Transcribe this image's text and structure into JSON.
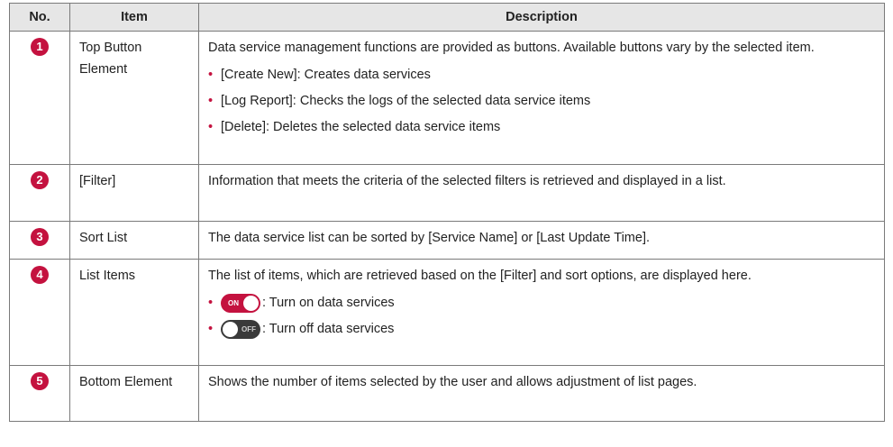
{
  "headers": {
    "no": "No.",
    "item": "Item",
    "description": "Description"
  },
  "rows": [
    {
      "no": "1",
      "item": "Top Button Element",
      "text": "Data service management functions are provided as buttons. Available buttons vary by the selected item.",
      "bullets": [
        "[Create New]: Creates data services",
        "[Log Report]: Checks the logs of the selected data service items",
        "[Delete]: Deletes the selected data service items"
      ]
    },
    {
      "no": "2",
      "item": "[Filter]",
      "text": "Information that meets the criteria of the selected filters is retrieved and displayed in a list."
    },
    {
      "no": "3",
      "item": "Sort List",
      "text": "The data service list can be sorted by [Service Name] or [Last Update Time]."
    },
    {
      "no": "4",
      "item": "List Items",
      "text": "The list of items, which are retrieved based on the [Filter] and sort options, are displayed here.",
      "toggles": [
        {
          "label": "ON",
          "state": "on",
          "text": ": Turn on data services"
        },
        {
          "label": "OFF",
          "state": "off",
          "text": ": Turn off data services"
        }
      ]
    },
    {
      "no": "5",
      "item": "Bottom Element",
      "text": "Shows the number of items selected by the user and allows adjustment of list pages."
    }
  ],
  "colors": {
    "accent": "#c4123f",
    "header_bg": "#e6e6e6",
    "border": "#7a7a7a",
    "toggle_off": "#3a3a3a"
  }
}
